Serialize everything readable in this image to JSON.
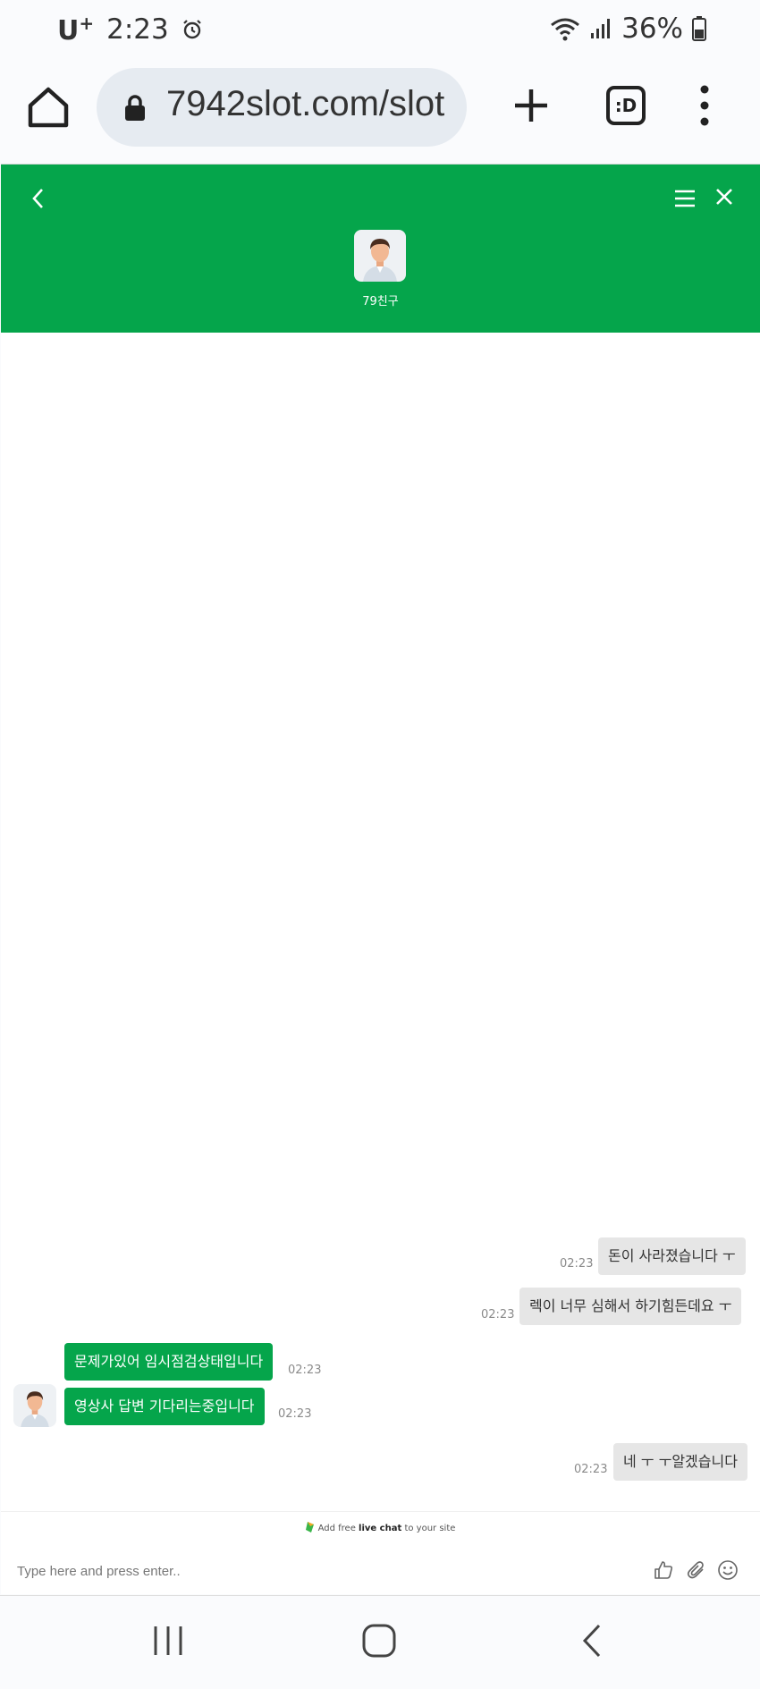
{
  "status_bar": {
    "carrier": "U",
    "carrier_sup": "+",
    "time": "2:23",
    "battery": "36%"
  },
  "browser": {
    "url": "7942slot.com/slot",
    "tabs_label": ":D"
  },
  "chat": {
    "agent_name": "79친구",
    "messages": [
      {
        "side": "out",
        "text": "돈이 사라졌습니다 ㅜ",
        "time": "02:23"
      },
      {
        "side": "out",
        "text": "렉이 너무 심해서 하기힘든데요 ㅜ",
        "time": "02:23"
      },
      {
        "side": "in",
        "text": "문제가있어 임시점검상태입니다",
        "time": "02:23"
      },
      {
        "side": "in",
        "text": "영상사 답변 기다리는중입니다",
        "time": "02:23"
      },
      {
        "side": "out",
        "text": "네 ㅜ ㅜ알겠습니다",
        "time": "02:23"
      }
    ],
    "powered_prefix": "Add free ",
    "powered_bold": "live chat",
    "powered_suffix": " to your site",
    "input_placeholder": "Type here and press enter.."
  },
  "colors": {
    "brand_green": "#05a54b",
    "outgoing_bubble": "#e6e6e6"
  },
  "icons": [
    "alarm-icon",
    "wifi-icon",
    "signal-icon",
    "battery-icon",
    "home-icon",
    "lock-icon",
    "plus-icon",
    "more-icon",
    "back-icon",
    "menu-icon",
    "close-icon",
    "thumbs-up-icon",
    "attach-icon",
    "emoji-icon"
  ]
}
